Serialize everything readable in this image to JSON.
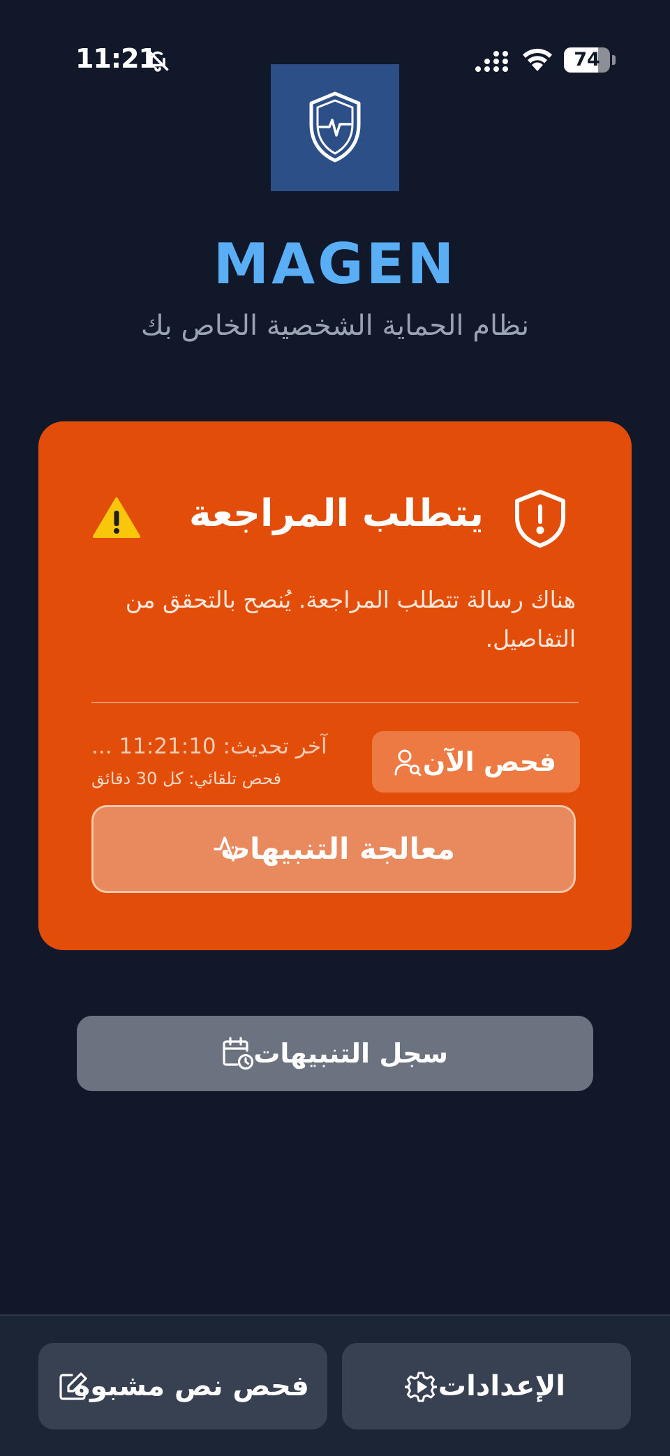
{
  "status_bar": {
    "time": "11:21",
    "battery_percent": "74",
    "battery_level": 0.74,
    "icons": [
      "bell-slash-icon",
      "signal-icon",
      "wifi-icon",
      "battery-icon"
    ]
  },
  "header": {
    "logo_icon": "shield-pulse-icon",
    "title": "MAGEN",
    "subtitle": "نظام الحماية الشخصية الخاص بك"
  },
  "alert_card": {
    "color": "#e24e0a",
    "title": "يتطلب المراجعة",
    "warning_icon": "warning-icon",
    "shield_icon": "shield-alert-icon",
    "message": "هناك رسالة تتطلب المراجعة. يُنصح بالتحقق من التفاصيل.",
    "last_update": "آخر تحديث: 11:21:10 ...",
    "auto_scan": "فحص تلقائي: كل 30 دقائق",
    "scan_now_label": "فحص الآن",
    "process_alerts_label": "معالجة التنبيهات"
  },
  "history_button": {
    "label": "سجل التنبيهات",
    "icon": "calendar-clock-icon"
  },
  "bottom_nav": {
    "scan_text_label": "فحص نص مشبوه",
    "scan_text_icon": "edit-icon",
    "settings_label": "الإعدادات",
    "settings_icon": "gear-icon"
  }
}
